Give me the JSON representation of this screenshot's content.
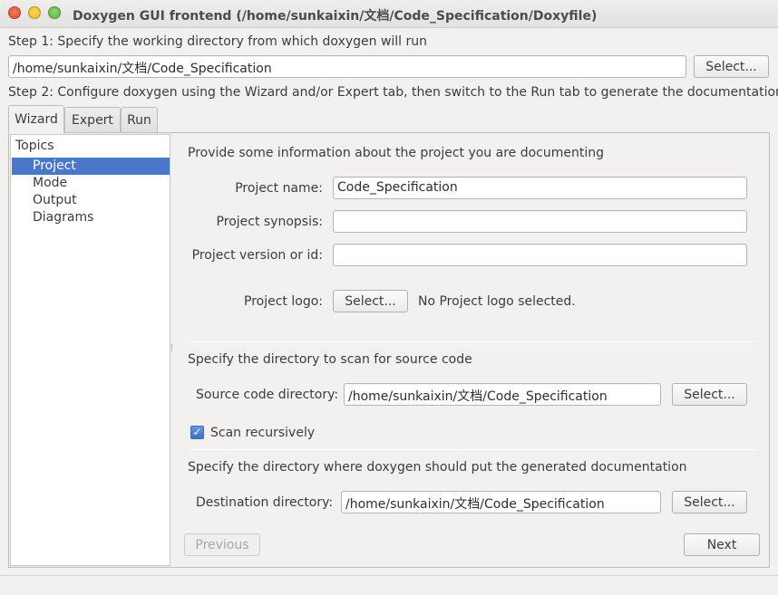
{
  "window": {
    "title": "Doxygen GUI frontend (/home/sunkaixin/文档/Code_Specification/Doxyfile)"
  },
  "step1": {
    "label": "Step 1: Specify the working directory from which doxygen will run",
    "working_dir": "/home/sunkaixin/文档/Code_Specification",
    "select_label": "Select..."
  },
  "step2": {
    "label": "Step 2: Configure doxygen using the Wizard and/or Expert tab, then switch to the Run tab to generate the documentation"
  },
  "tabs": [
    "Wizard",
    "Expert",
    "Run"
  ],
  "topics": {
    "header": "Topics",
    "items": [
      "Project",
      "Mode",
      "Output",
      "Diagrams"
    ],
    "selected": "Project"
  },
  "project": {
    "heading": "Provide some information about the project you are documenting",
    "name_label": "Project name:",
    "name_value": "Code_Specification",
    "synopsis_label": "Project synopsis:",
    "synopsis_value": "",
    "version_label": "Project version or id:",
    "version_value": "",
    "logo_label": "Project logo:",
    "logo_button": "Select...",
    "logo_status": "No Project logo selected."
  },
  "source": {
    "heading": "Specify the directory to scan for source code",
    "dir_label": "Source code directory:",
    "dir_value": "/home/sunkaixin/文档/Code_Specification",
    "select_label": "Select...",
    "recursive_label": "Scan recursively",
    "recursive_checked": true
  },
  "destination": {
    "heading": "Specify the directory where doxygen should put the generated documentation",
    "dir_label": "Destination directory:",
    "dir_value": "/home/sunkaixin/文档/Code_Specification",
    "select_label": "Select..."
  },
  "nav": {
    "previous": "Previous",
    "next": "Next"
  }
}
